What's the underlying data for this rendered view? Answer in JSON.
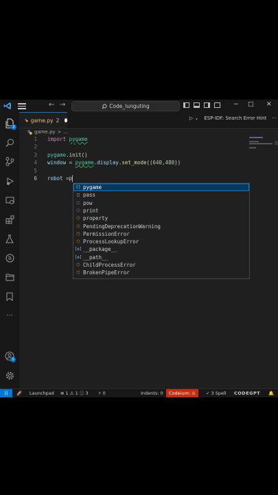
{
  "titlebar": {
    "search_text": "Code_lunguting",
    "back_icon": "arrow-left-icon",
    "forward_icon": "arrow-right-icon",
    "window_controls": [
      "−",
      "□",
      "✕"
    ]
  },
  "tabs": [
    {
      "label": "game.py",
      "number": "2",
      "modified": true
    }
  ],
  "run_area": {
    "esp_label": "ESP-IDF: Search Error Hint"
  },
  "breadcrumb": {
    "file": "game.py",
    "sep": ">",
    "tail": "..."
  },
  "code_lines": [
    {
      "num": "1",
      "parts": [
        [
          "kw",
          "import "
        ],
        [
          "mod sq",
          "pygame"
        ]
      ]
    },
    {
      "num": "2",
      "parts": []
    },
    {
      "num": "3",
      "parts": [
        [
          "mod",
          "pygame"
        ],
        [
          "plain",
          "."
        ],
        [
          "fn",
          "init"
        ],
        [
          "plain",
          "()"
        ]
      ]
    },
    {
      "num": "4",
      "parts": [
        [
          "var",
          "window"
        ],
        [
          "plain",
          " = "
        ],
        [
          "mod sq",
          "pygame"
        ],
        [
          "plain",
          "."
        ],
        [
          "var",
          "display"
        ],
        [
          "plain",
          "."
        ],
        [
          "fn",
          "set_mode"
        ],
        [
          "plain",
          "(("
        ],
        [
          "num",
          "640"
        ],
        [
          "plain",
          ","
        ],
        [
          "num",
          "480"
        ],
        [
          "plain",
          "))"
        ]
      ]
    },
    {
      "num": "5",
      "parts": []
    },
    {
      "num": "6",
      "parts": [
        [
          "var",
          "robot"
        ],
        [
          "plain",
          " ="
        ],
        [
          "plain",
          "p"
        ]
      ]
    }
  ],
  "suggestions": [
    {
      "label": "pygame",
      "kind": "module",
      "icon": "()"
    },
    {
      "label": "pass",
      "kind": "keyword",
      "icon": "□"
    },
    {
      "label": "pow",
      "kind": "function",
      "icon": "⬡"
    },
    {
      "label": "print",
      "kind": "function",
      "icon": "⬡"
    },
    {
      "label": "property",
      "kind": "class",
      "icon": "⬡"
    },
    {
      "label": "PendingDeprecationWarning",
      "kind": "class",
      "icon": "⬡"
    },
    {
      "label": "PermissionError",
      "kind": "class",
      "icon": "⬡"
    },
    {
      "label": "ProcessLookupError",
      "kind": "class",
      "icon": "⬡"
    },
    {
      "label": "__package__",
      "kind": "variable",
      "icon": "[e]"
    },
    {
      "label": "__path__",
      "kind": "variable",
      "icon": "[e]"
    },
    {
      "label": "ChildProcessError",
      "kind": "class",
      "icon": "⬡"
    },
    {
      "label": "BrokenPipeError",
      "kind": "class",
      "icon": "⬡"
    }
  ],
  "status": {
    "launchpad": "Launchpad",
    "errors": "1",
    "warnings": "1",
    "infos": "3",
    "ports": "0",
    "indents": "Indents: 0",
    "codeium": "Codeium:",
    "spell": "3 Spell",
    "codegpt": "CODEGPT"
  },
  "colors": {
    "accent": "#0078d4",
    "codeium_bg": "#c72e0f",
    "editor_bg": "#1f1f1f"
  }
}
